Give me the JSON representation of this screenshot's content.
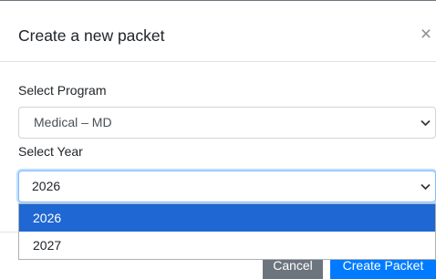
{
  "modal": {
    "title": "Create a new packet",
    "close_glyph": "×"
  },
  "form": {
    "program": {
      "label": "Select Program",
      "value": "Medical – MD"
    },
    "year": {
      "label": "Select Year",
      "value": "2026",
      "options": [
        "2026",
        "2027"
      ],
      "highlighted_option": "2026",
      "dropdown_open": true
    }
  },
  "footer": {
    "cancel_label": "Cancel",
    "create_label": "Create Packet"
  },
  "colors": {
    "primary": "#007bff",
    "secondary": "#6c757d",
    "option_highlight": "#1f67d2"
  },
  "icons": {
    "close": "close-icon",
    "select_arrow": "chevron-down-icon"
  }
}
